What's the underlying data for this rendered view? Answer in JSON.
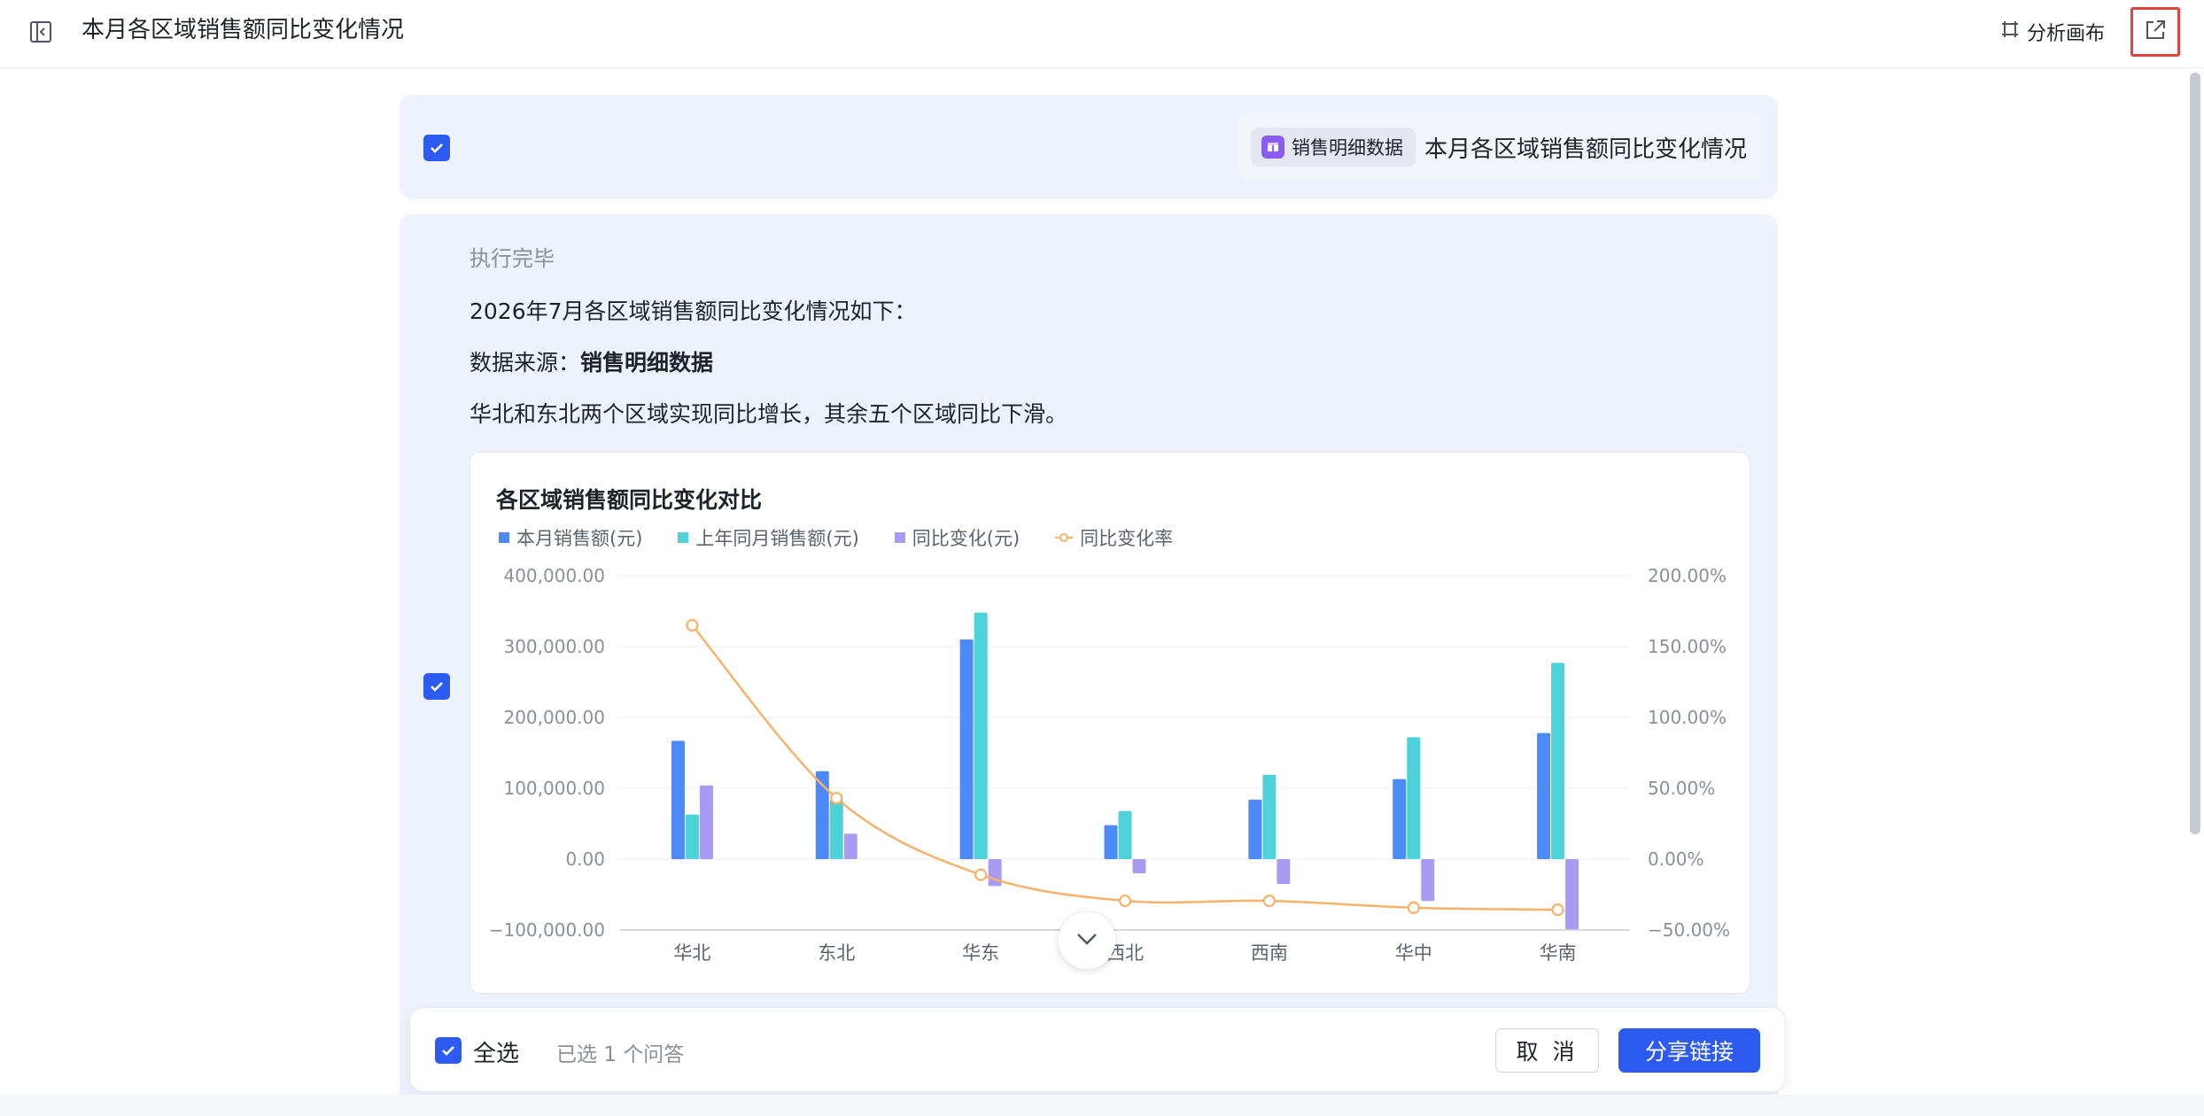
{
  "header": {
    "title": "本月各区域销售额同比变化情况",
    "canvas_label": "分析画布"
  },
  "question": {
    "datasource_tag": "销售明细数据",
    "text": "本月各区域销售额同比变化情况"
  },
  "answer": {
    "status": "执行完毕",
    "summary_line": "2026年7月各区域销售额同比变化情况如下：",
    "source_prefix": "数据来源：",
    "source_name": "销售明细数据",
    "conclusion": "华北和东北两个区域实现同比增长，其余五个区域同比下滑。"
  },
  "chart_data": {
    "type": "bar",
    "title": "各区域销售额同比变化对比",
    "categories": [
      "华北",
      "东北",
      "华东",
      "西北",
      "西南",
      "华中",
      "华南"
    ],
    "series": [
      {
        "name": "本月销售额(元)",
        "type": "bar",
        "axis": "left",
        "color": "#4c8bf5",
        "values": [
          167000,
          124000,
          310000,
          48000,
          84000,
          113000,
          178000
        ]
      },
      {
        "name": "上年同月销售额(元)",
        "type": "bar",
        "axis": "left",
        "color": "#4fd1d9",
        "values": [
          63000,
          83000,
          348000,
          68000,
          119000,
          172000,
          277000
        ]
      },
      {
        "name": "同比变化(元)",
        "type": "bar",
        "axis": "left",
        "color": "#a99bf2",
        "values": [
          104000,
          36000,
          -38000,
          -20000,
          -35000,
          -59000,
          -99000
        ]
      },
      {
        "name": "同比变化率",
        "type": "line",
        "axis": "right",
        "color": "#f7b26a",
        "values": [
          165,
          43,
          -11,
          -29.4,
          -29.4,
          -34.3,
          -35.7
        ]
      }
    ],
    "left_axis": {
      "ticks": [
        "400,000.00",
        "300,000.00",
        "200,000.00",
        "100,000.00",
        "0.00",
        "−100,000.00"
      ],
      "ylim": [
        -100000,
        400000
      ]
    },
    "right_axis": {
      "ticks": [
        "200.00%",
        "150.00%",
        "100.00%",
        "50.00%",
        "0.00%",
        "−50.00%"
      ],
      "ylim": [
        -50,
        200
      ]
    },
    "grid": true,
    "legend": "top-left"
  },
  "actions": {
    "select_all_label": "全选",
    "selected_count": "已选 1 个问答",
    "cancel_label": "取 消",
    "share_label": "分享链接"
  }
}
